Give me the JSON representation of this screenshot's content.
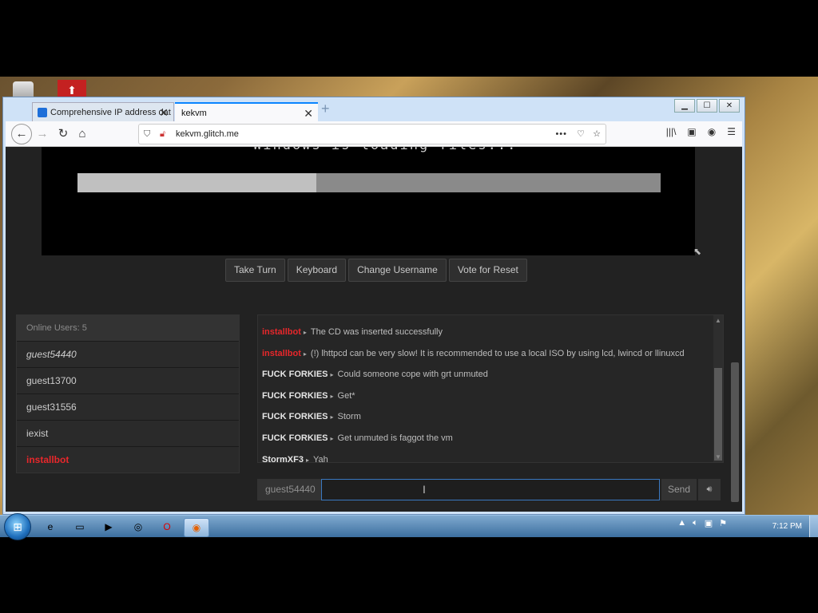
{
  "browser": {
    "tabs": [
      {
        "label": "Comprehensive IP address dat",
        "active": false
      },
      {
        "label": "kekvm",
        "active": true
      }
    ],
    "new_tab_label": "+",
    "url": "kekvm.glitch.me",
    "window_controls": {
      "minimize": "▁",
      "maximize": "☐",
      "close": "✕"
    }
  },
  "vm": {
    "screen_text": "Windows is loading files...",
    "progress_fraction": 0.41,
    "buttons": [
      "Take Turn",
      "Keyboard",
      "Change Username",
      "Vote for Reset"
    ]
  },
  "users": {
    "header": "Online Users: 5",
    "list": [
      {
        "name": "guest54440",
        "style": "italic"
      },
      {
        "name": "guest13700",
        "style": "normal"
      },
      {
        "name": "guest31556",
        "style": "normal"
      },
      {
        "name": "iexist",
        "style": "normal"
      },
      {
        "name": "installbot",
        "style": "red"
      }
    ]
  },
  "chat": {
    "messages": [
      {
        "user": "installbot",
        "red": true,
        "text": "The CD was inserted successfully"
      },
      {
        "user": "installbot",
        "red": true,
        "text": "(!) lhttpcd can be very slow! It is recommended to use a local ISO by using lcd, lwincd or llinuxcd"
      },
      {
        "user": "FUCK FORKIES",
        "red": false,
        "text": "Could someone cope with grt unmuted"
      },
      {
        "user": "FUCK FORKIES",
        "red": false,
        "text": "Get*"
      },
      {
        "user": "FUCK FORKIES",
        "red": false,
        "text": "Storm"
      },
      {
        "user": "FUCK FORKIES",
        "red": false,
        "text": "Get unmuted is faggot the vm"
      },
      {
        "user": "StormXF3",
        "red": false,
        "text": "Yah"
      }
    ],
    "username_display": "guest54440",
    "send_label": "Send",
    "sound_icon": "speaker-icon"
  },
  "taskbar": {
    "clock": "7:12 PM",
    "apps": [
      "ie-icon",
      "explorer-icon",
      "media-player-icon",
      "chrome-icon",
      "opera-icon",
      "firefox-icon"
    ]
  },
  "colors": {
    "accent_red": "#e8272b",
    "page_bg": "#222222",
    "focus_blue": "#3a78c0"
  }
}
